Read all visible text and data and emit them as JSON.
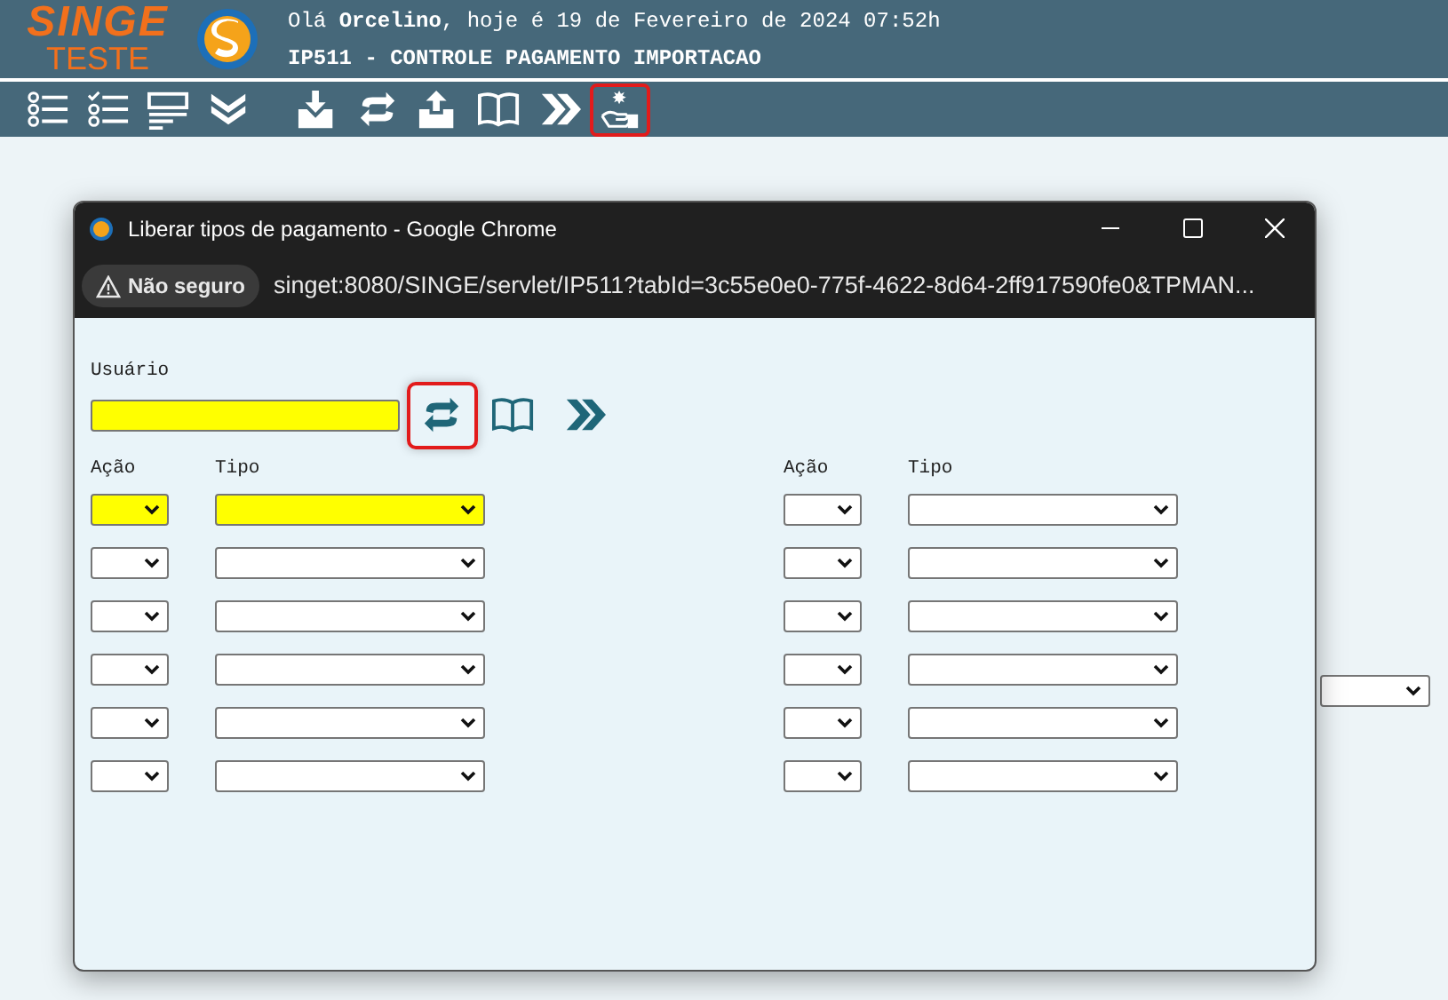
{
  "header": {
    "logo_title": "SINGE",
    "logo_subtitle": "TESTE",
    "greeting": "Olá **Orcelino**, hoje é 19 de Fevereiro de 2024 07:52h",
    "program_title": "IP511 - CONTROLE PAGAMENTO IMPORTACAO"
  },
  "toolbar": [
    {
      "kind": "list",
      "highlighted": false
    },
    {
      "kind": "checklist",
      "highlighted": false
    },
    {
      "kind": "form",
      "highlighted": false
    },
    {
      "kind": "chevrons-down",
      "highlighted": false
    },
    {
      "kind": "download",
      "highlighted": false
    },
    {
      "kind": "swap",
      "highlighted": false
    },
    {
      "kind": "upload",
      "highlighted": false
    },
    {
      "kind": "book",
      "highlighted": false
    },
    {
      "kind": "forward",
      "highlighted": false
    },
    {
      "kind": "hand",
      "highlighted": true
    }
  ],
  "popup": {
    "title": "Liberar tipos de pagamento - Google Chrome",
    "security_label": "Não seguro",
    "url": "singet:8080/SINGE/servlet/IP511?tabId=3c55e0e0-775f-4622-8d64-2ff917590fe0&TPMAN...",
    "user_label": "Usuário",
    "user_field": {
      "required": true
    },
    "tools": [
      {
        "kind": "swap",
        "highlighted": true
      },
      {
        "kind": "book",
        "highlighted": false
      },
      {
        "kind": "forward",
        "highlighted": false
      }
    ],
    "groups": [
      {
        "action_label": "Ação",
        "type_label": "Tipo",
        "rows": [
          {
            "required": true
          },
          {
            "required": false
          },
          {
            "required": false
          },
          {
            "required": false
          },
          {
            "required": false
          },
          {
            "required": false
          }
        ]
      },
      {
        "action_label": "Ação",
        "type_label": "Tipo",
        "rows": [
          {
            "required": false
          },
          {
            "required": false
          },
          {
            "required": false
          },
          {
            "required": false
          },
          {
            "required": false
          },
          {
            "required": false
          }
        ]
      }
    ]
  }
}
